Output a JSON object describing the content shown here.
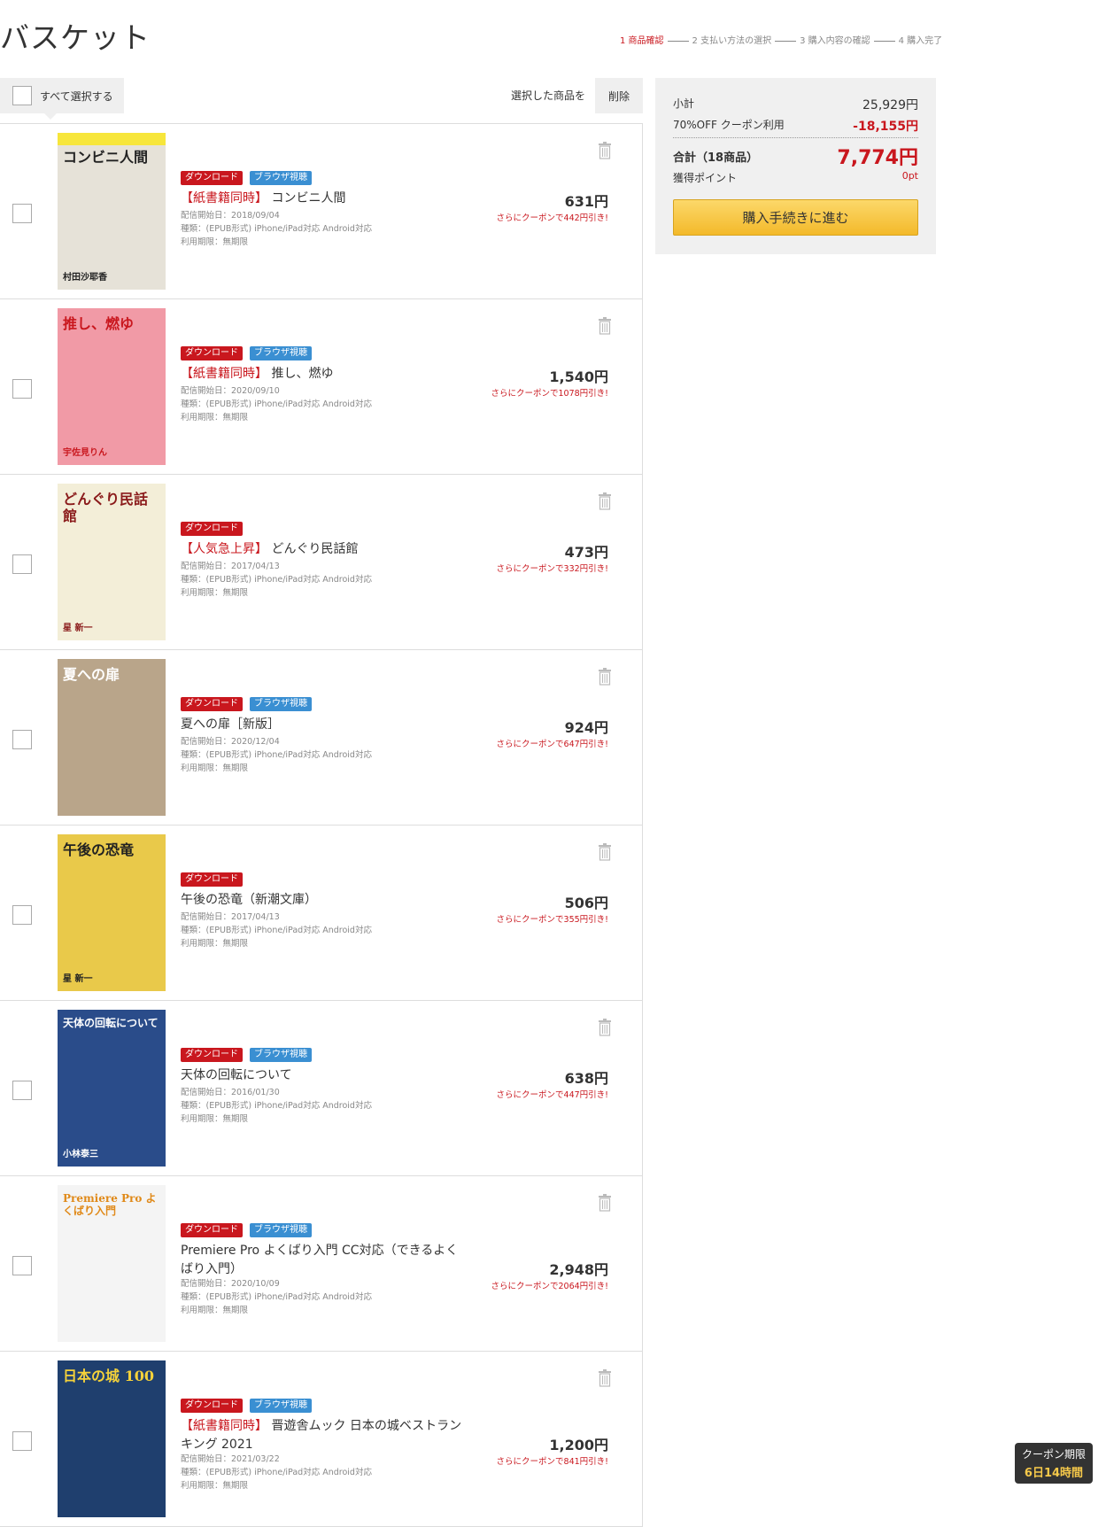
{
  "header": {
    "title": "バスケット",
    "steps": [
      {
        "label": "1 商品確認",
        "active": true
      },
      {
        "label": "2 支払い方法の選択",
        "active": false
      },
      {
        "label": "3 購入内容の確認",
        "active": false
      },
      {
        "label": "4 購入完了",
        "active": false
      }
    ]
  },
  "toolbar": {
    "select_all_label": "すべて選択する",
    "selected_label": "選択した商品を",
    "delete_label": "削除"
  },
  "items": [
    {
      "badge_dl": "ダウンロード",
      "badge_br": "ブラウザ視聴",
      "tag": "【紙書籍同時】",
      "title": " コンビニ人間",
      "date": "配信開始日：2018/09/04",
      "kind": "種類：(EPUB形式) iPhone/iPad対応 Android対応",
      "period": "利用期限：無期限",
      "price": "631円",
      "coupon": "さらにクーポンで442円引き!"
    },
    {
      "badge_dl": "ダウンロード",
      "badge_br": "ブラウザ視聴",
      "tag": "【紙書籍同時】",
      "title": " 推し、燃ゆ",
      "date": "配信開始日：2020/09/10",
      "kind": "種類：(EPUB形式) iPhone/iPad対応 Android対応",
      "period": "利用期限：無期限",
      "price": "1,540円",
      "coupon": "さらにクーポンで1078円引き!"
    },
    {
      "badge_dl": "ダウンロード",
      "badge_br": "",
      "tag": "【人気急上昇】",
      "title": " どんぐり民話館",
      "date": "配信開始日：2017/04/13",
      "kind": "種類：(EPUB形式) iPhone/iPad対応 Android対応",
      "period": "利用期限：無期限",
      "price": "473円",
      "coupon": "さらにクーポンで332円引き!"
    },
    {
      "badge_dl": "ダウンロード",
      "badge_br": "ブラウザ視聴",
      "tag": "",
      "title": "夏への扉［新版］",
      "date": "配信開始日：2020/12/04",
      "kind": "種類：(EPUB形式) iPhone/iPad対応 Android対応",
      "period": "利用期限：無期限",
      "price": "924円",
      "coupon": "さらにクーポンで647円引き!"
    },
    {
      "badge_dl": "ダウンロード",
      "badge_br": "",
      "tag": "",
      "title": "午後の恐竜（新潮文庫）",
      "date": "配信開始日：2017/04/13",
      "kind": "種類：(EPUB形式) iPhone/iPad対応 Android対応",
      "period": "利用期限：無期限",
      "price": "506円",
      "coupon": "さらにクーポンで355円引き!"
    },
    {
      "badge_dl": "ダウンロード",
      "badge_br": "ブラウザ視聴",
      "tag": "",
      "title": "天体の回転について",
      "date": "配信開始日：2016/01/30",
      "kind": "種類：(EPUB形式) iPhone/iPad対応 Android対応",
      "period": "利用期限：無期限",
      "price": "638円",
      "coupon": "さらにクーポンで447円引き!"
    },
    {
      "badge_dl": "ダウンロード",
      "badge_br": "ブラウザ視聴",
      "tag": "",
      "title": "Premiere Pro よくばり入門 CC対応（できるよくばり入門）",
      "date": "配信開始日：2020/10/09",
      "kind": "種類：(EPUB形式) iPhone/iPad対応 Android対応",
      "period": "利用期限：無期限",
      "price": "2,948円",
      "coupon": "さらにクーポンで2064円引き!"
    },
    {
      "badge_dl": "ダウンロード",
      "badge_br": "ブラウザ視聴",
      "tag": "【紙書籍同時】",
      "title": " 晋遊舎ムック 日本の城ベストランキング 2021",
      "date": "配信開始日：2021/03/22",
      "kind": "種類：(EPUB形式) iPhone/iPad対応 Android対応",
      "period": "利用期限：無期限",
      "price": "1,200円",
      "coupon": "さらにクーポンで841円引き!"
    }
  ],
  "covers": [
    {
      "text": "コンビニ人間",
      "author": "村田沙耶香",
      "bg": "#e6e2d8",
      "fg": "#222222",
      "band": "#f7e63b"
    },
    {
      "text": "推し、燃ゆ",
      "author": "宇佐見りん",
      "bg": "#f19aa6",
      "fg": "#c9171e",
      "band": ""
    },
    {
      "text": "どんぐり民話館",
      "author": "星 新一",
      "bg": "#f3eed8",
      "fg": "#8a1a1a",
      "band": ""
    },
    {
      "text": "夏への扉",
      "author": "",
      "bg": "#b9a58a",
      "fg": "#ffffff",
      "band": ""
    },
    {
      "text": "午後の恐竜",
      "author": "星 新一",
      "bg": "#e9c94a",
      "fg": "#222222",
      "band": ""
    },
    {
      "text": "天体の回転について",
      "author": "小林泰三",
      "bg": "#2a4c8a",
      "fg": "#ffffff",
      "band": ""
    },
    {
      "text": "Premiere Pro よくばり入門",
      "author": "",
      "bg": "#f4f4f4",
      "fg": "#e08a1a",
      "band": ""
    },
    {
      "text": "日本の城 100",
      "author": "",
      "bg": "#1f3f6e",
      "fg": "#f5d23a",
      "band": ""
    }
  ],
  "summary": {
    "subtotal_label": "小計",
    "subtotal": "25,929円",
    "coupon_label": "70%OFF クーポン利用",
    "coupon_value": "-18,155円",
    "total_label": "合計（18商品）",
    "total": "7,774円",
    "points_label": "獲得ポイント",
    "points": "0pt",
    "checkout_label": "購入手続きに進む"
  },
  "coupon_box": {
    "label": "クーポン期限",
    "value": "6日14時間"
  },
  "colors": {
    "accent": "#c9171e",
    "browser_badge": "#3a8fd2",
    "checkout": "#f3b92a"
  }
}
